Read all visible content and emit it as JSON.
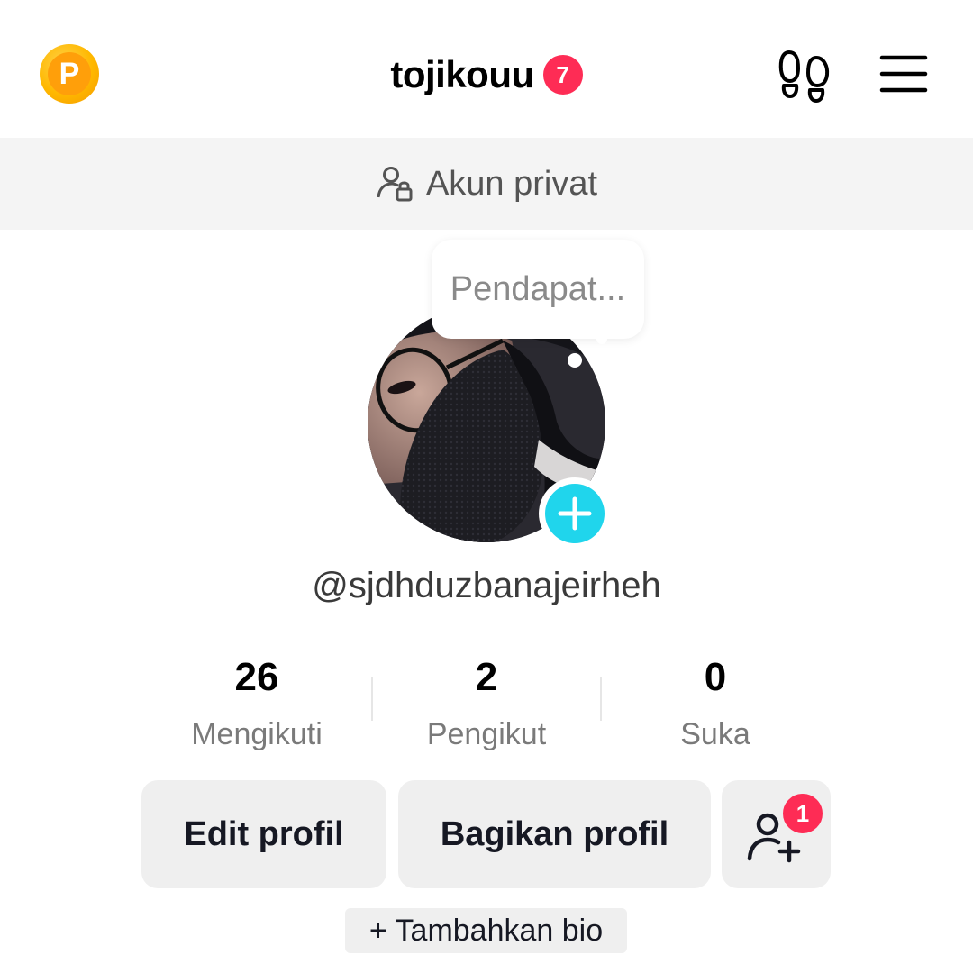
{
  "header": {
    "coin_letter": "P",
    "username": "tojikouu",
    "notification_count": "7"
  },
  "private_banner": {
    "label": "Akun privat"
  },
  "avatar": {
    "note_bubble": "Pendapat..."
  },
  "profile": {
    "handle": "@sjdhduzbanajeirheh"
  },
  "stats": [
    {
      "value": "26",
      "label": "Mengikuti"
    },
    {
      "value": "2",
      "label": "Pengikut"
    },
    {
      "value": "0",
      "label": "Suka"
    }
  ],
  "actions": {
    "edit_label": "Edit profil",
    "share_label": "Bagikan profil",
    "friends_badge": "1"
  },
  "bio": {
    "add_label": "+ Tambahkan bio"
  },
  "colors": {
    "accent_red": "#fe2c55",
    "accent_cyan": "#20d5ec",
    "coin": "#ffb800"
  },
  "icons": {
    "coin": "coin-icon",
    "footprint": "footprint-icon",
    "menu": "menu-icon",
    "private": "user-lock-icon",
    "add": "plus-icon",
    "add_friend": "add-friend-icon"
  }
}
